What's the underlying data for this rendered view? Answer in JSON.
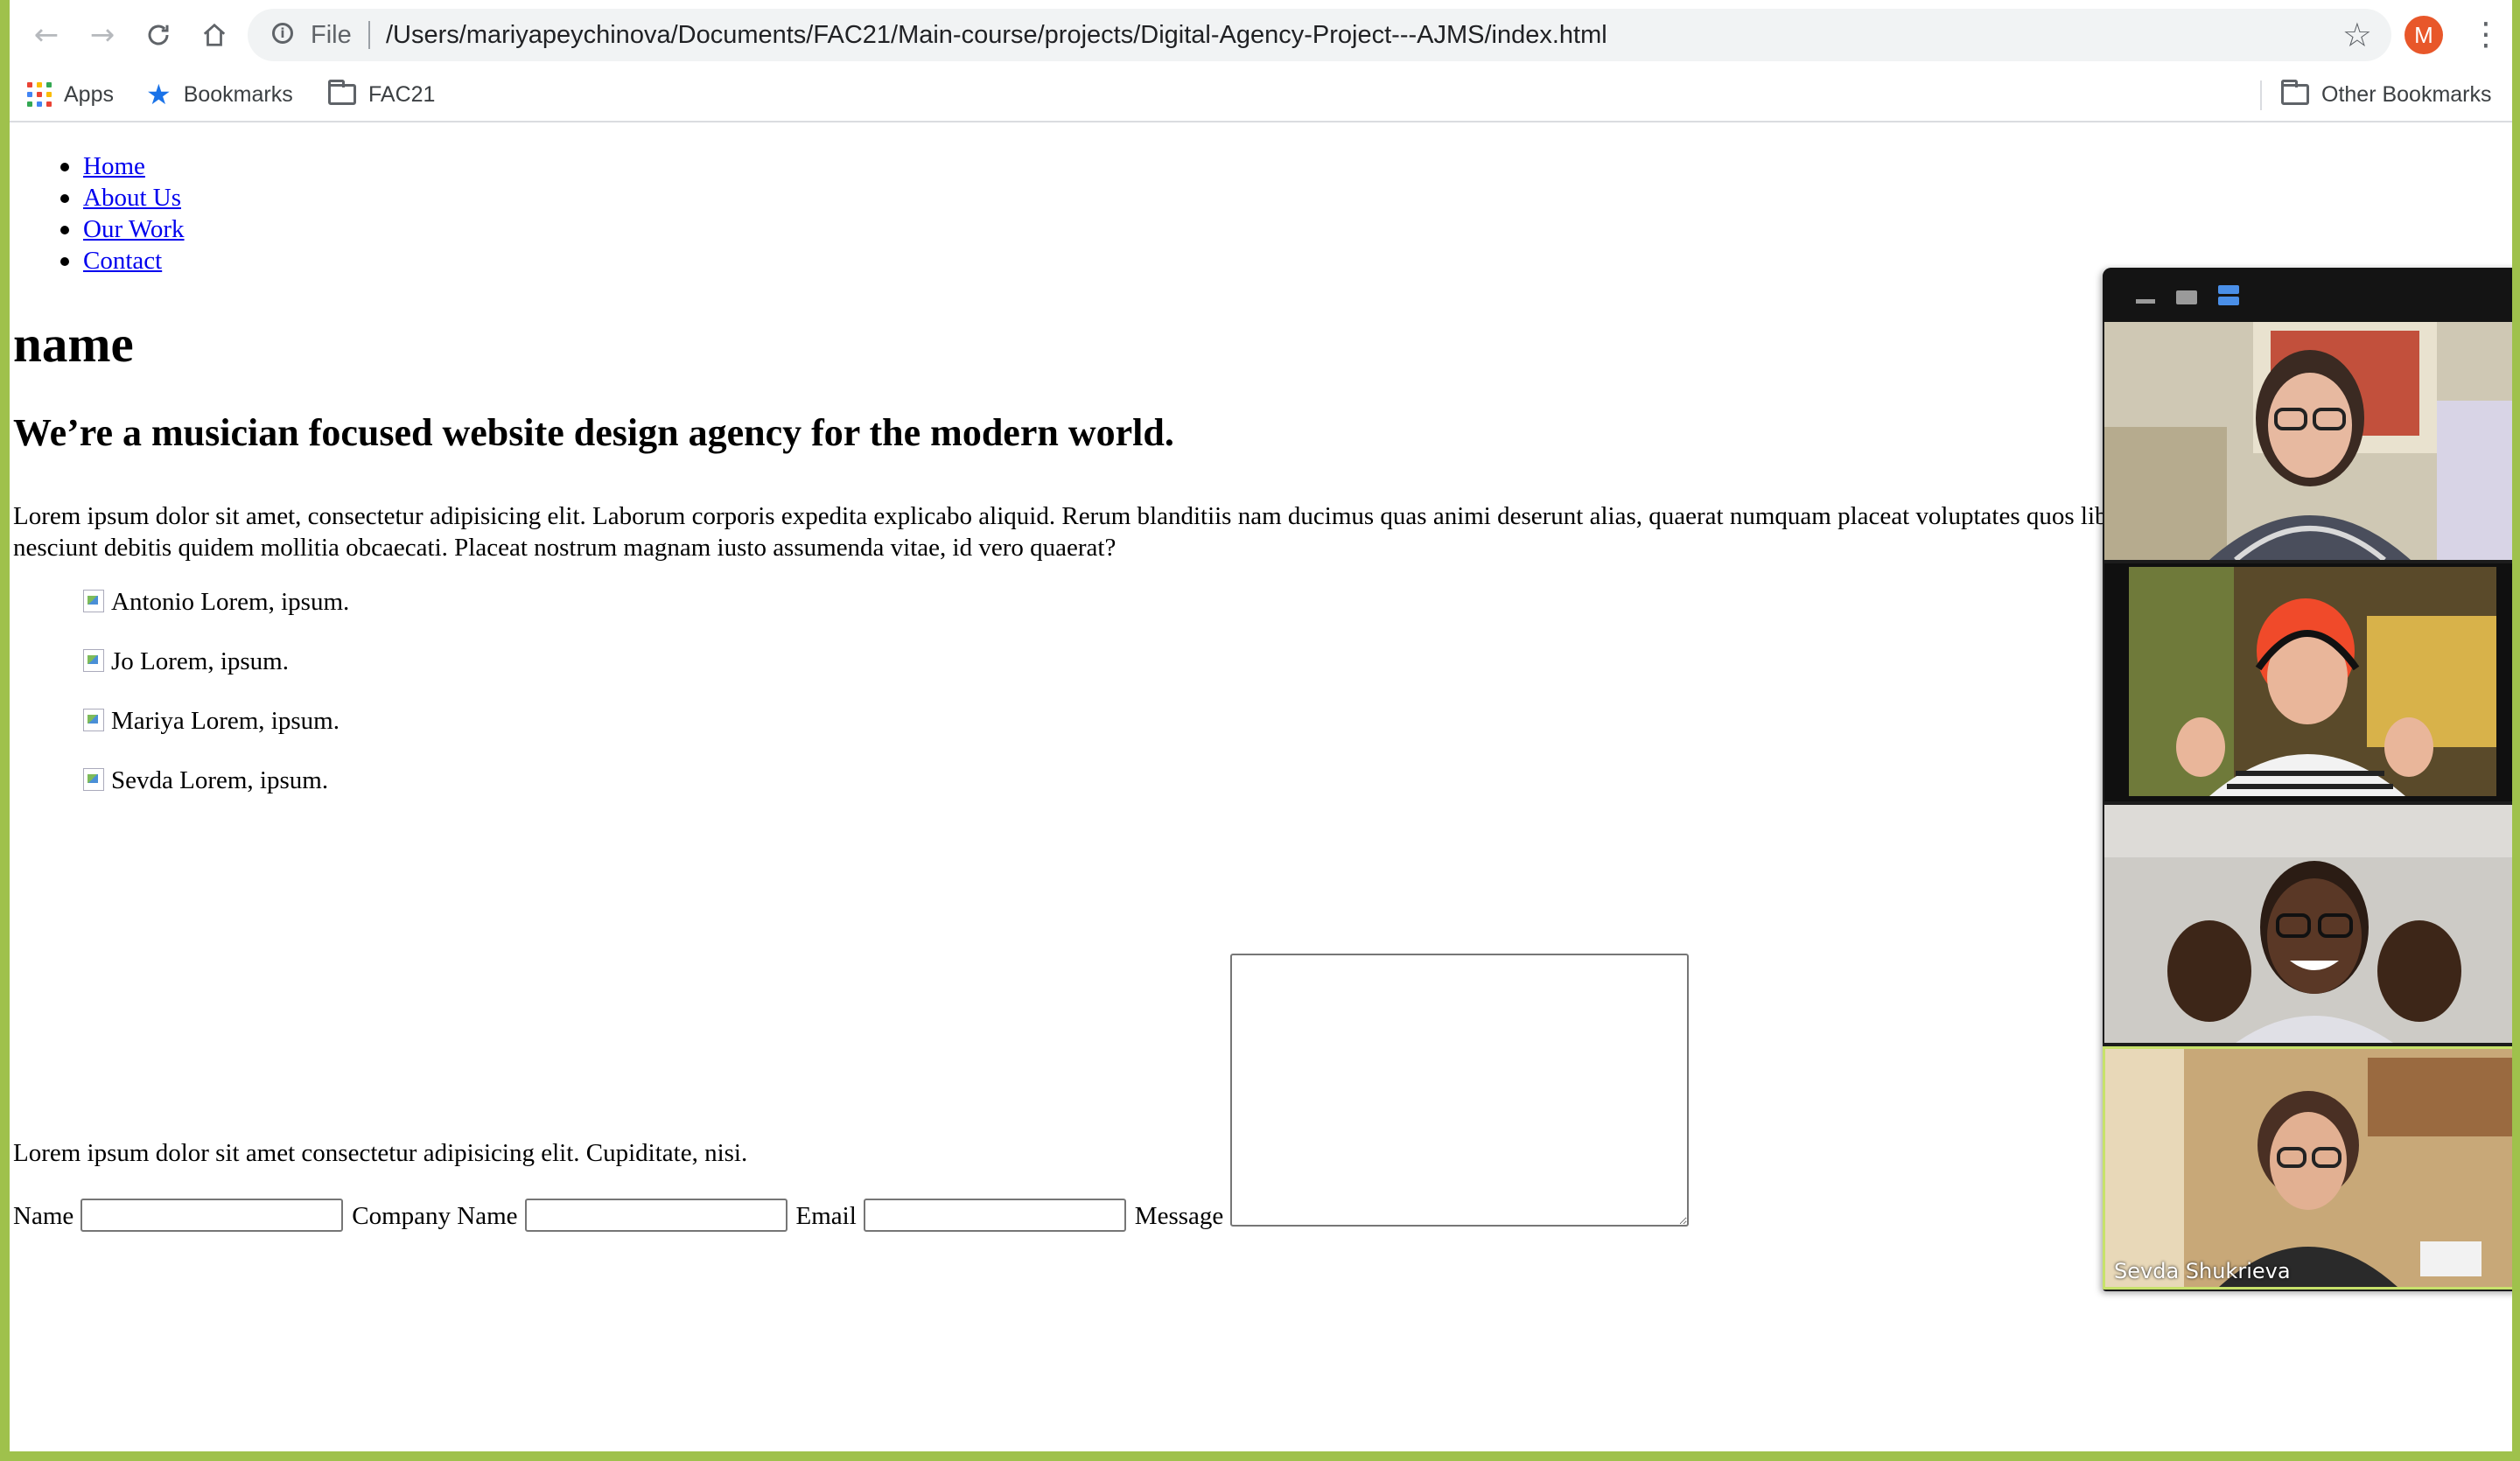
{
  "browser": {
    "scheme_label": "File",
    "url": "/Users/mariyapeychinova/Documents/FAC21/Main-course/projects/Digital-Agency-Project---AJMS/index.html",
    "profile_initial": "M",
    "bookmarks": [
      {
        "label": "Apps",
        "icon": "apps-icon"
      },
      {
        "label": "Bookmarks",
        "icon": "star-icon"
      },
      {
        "label": "FAC21",
        "icon": "folder-icon"
      }
    ],
    "other_bookmarks": "Other Bookmarks"
  },
  "site": {
    "nav": [
      "Home",
      "About Us",
      "Our Work",
      "Contact"
    ],
    "title": "name",
    "tagline": "We’re a musician focused website design agency for the modern world.",
    "intro": "Lorem ipsum dolor sit amet, consectetur adipisicing elit. Laborum corporis expedita explicabo aliquid. Rerum blanditiis nam ducimus quas animi deserunt alias, quaerat numquam placeat voluptates quos libero nihil veritatis fuga possimus, nesciunt debitis quidem mollitia obcaecati. Placeat nostrum magnam iusto assumenda vitae, id vero quaerat?",
    "team": [
      "Antonio Lorem, ipsum.",
      "Jo Lorem, ipsum.",
      "Mariya Lorem, ipsum.",
      "Sevda Lorem, ipsum."
    ],
    "form": {
      "name_label": "Name",
      "company_label": "Company Name",
      "email_label": "Email",
      "message_label": "Message"
    },
    "footer": "Lorem ipsum dolor sit amet consectetur adipisicing elit. Cupiditate, nisi."
  },
  "video_call": {
    "participant_label": "Sevda Shukrieva"
  }
}
